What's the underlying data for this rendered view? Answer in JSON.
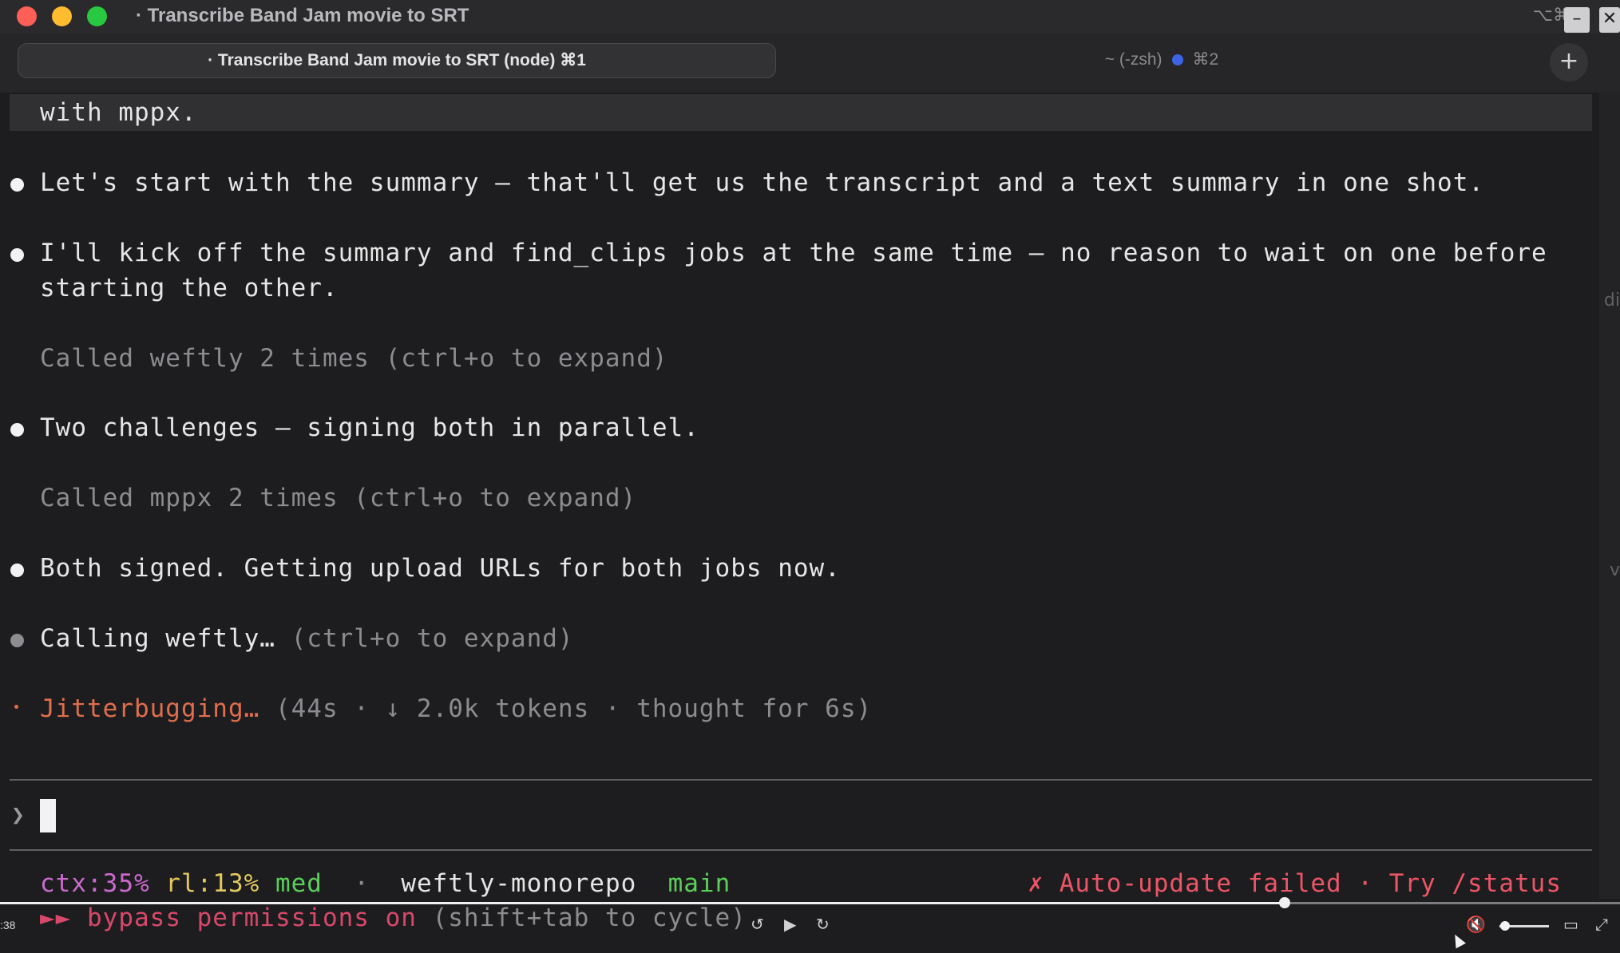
{
  "window": {
    "title": "· Transcribe Band Jam movie to SRT",
    "shortcut_hint": "⌥⌘",
    "overlay_minimize": "–",
    "overlay_close": "✕"
  },
  "tabs": [
    {
      "label": "· Transcribe Band Jam movie to SRT (node) ⌘1",
      "active": true
    },
    {
      "label": "~ (-zsh)",
      "shortcut": "⌘2",
      "active": false
    }
  ],
  "new_tab_label": "+",
  "right_edge_fragments": [
    "di",
    "v"
  ],
  "terminal": {
    "previous_line": "with mppx.",
    "messages": [
      {
        "text": "Let's start with the summary — that'll get us the transcript and a text summary in one shot."
      },
      {
        "lines": [
          "I'll kick off the summary and find_clips jobs at the same time — no reason to wait on one before",
          "starting the other."
        ]
      },
      {
        "tool_note": "Called weftly 2 times (ctrl+o to expand)"
      },
      {
        "text": "Two challenges — signing both in parallel."
      },
      {
        "tool_note": "Called mppx 2 times (ctrl+o to expand)"
      },
      {
        "text": "Both signed. Getting upload URLs for both jobs now."
      },
      {
        "text": "Calling weftly…",
        "hint": " (ctrl+o to expand)"
      }
    ],
    "spinner": {
      "verb": "Jitterbugging…",
      "detail": " (44s · ↓ 2.0k tokens · thought for 6s)"
    },
    "prompt_caret": "❯"
  },
  "statusline": {
    "ctx": "ctx:35%",
    "rl": "rl:13%",
    "effort": "med",
    "separator": "·",
    "repo": "weftly-monorepo",
    "branch": "main",
    "update_warning": "✗ Auto-update failed · Try /status",
    "mode_arrows": "►►",
    "mode": "bypass permissions on",
    "mode_hint": " (shift+tab to cycle)"
  },
  "player": {
    "time": ":38",
    "progress": 0.793,
    "volume": 0.05,
    "rewind_icon": "↺",
    "play_icon": "▶",
    "forward_icon": "↻",
    "mute_icon": "🔇",
    "captions_icon": "▭",
    "fullscreen_icon": "⤢"
  },
  "colors": {
    "ctx": "#cc6ad0",
    "rl": "#e2c95d",
    "effort": "#5ad05a",
    "branch": "#5ad05a",
    "warning": "#ec5566",
    "mode": "#d8486a",
    "spinner": "#e06e4d"
  }
}
